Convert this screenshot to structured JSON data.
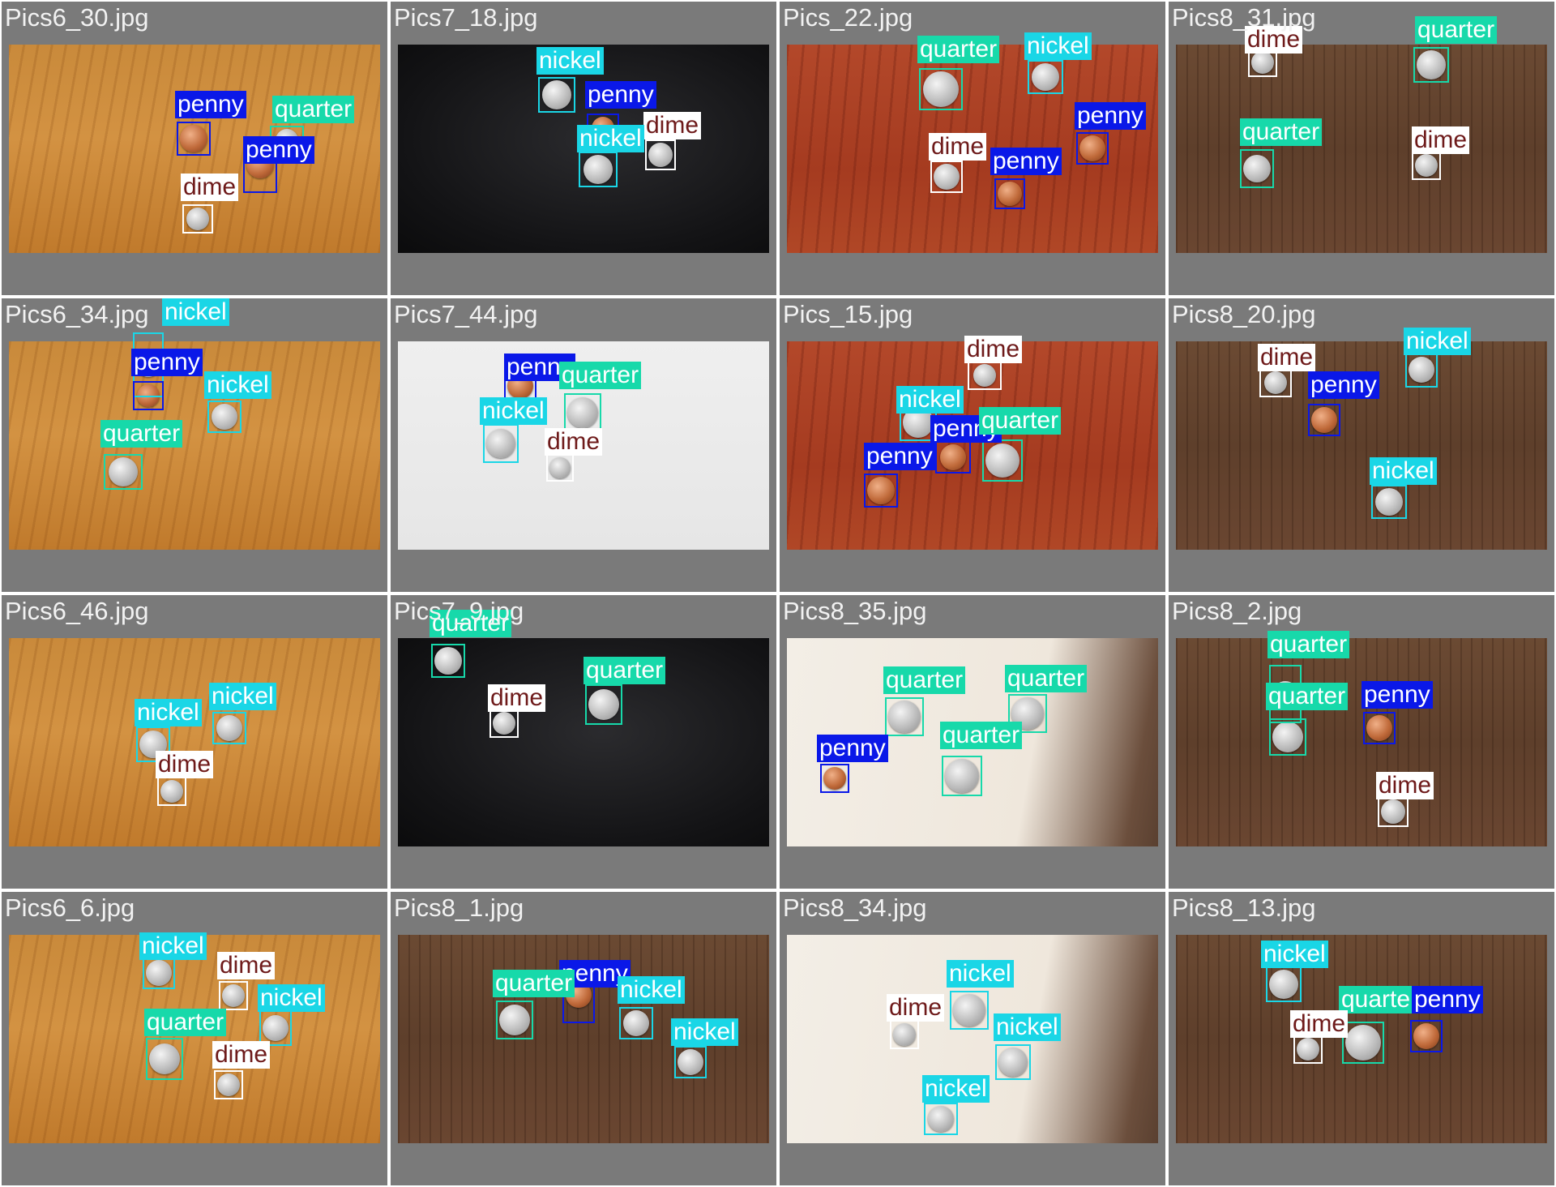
{
  "colors": {
    "penny": "#0a18e8",
    "quarter": "#17d9aa",
    "nickel": "#1ad6e6",
    "dime": "#ffffff",
    "dime_text": "#6e1a1a",
    "light_text": "#ffffff",
    "tile_bg": "#7a7a7a"
  },
  "tiles": [
    {
      "filename": "Pics6_30.jpg",
      "bg": "wood-orange",
      "detections": [
        {
          "class": "penny"
        },
        {
          "class": "quarter"
        },
        {
          "class": "penny"
        },
        {
          "class": "dime"
        }
      ]
    },
    {
      "filename": "Pics7_18.jpg",
      "bg": "dark",
      "detections": [
        {
          "class": "nickel"
        },
        {
          "class": "penny"
        },
        {
          "class": "dime"
        },
        {
          "class": "nickel"
        }
      ]
    },
    {
      "filename": "Pics_22.jpg",
      "bg": "wood-red",
      "detections": [
        {
          "class": "quarter"
        },
        {
          "class": "nickel"
        },
        {
          "class": "penny"
        },
        {
          "class": "dime"
        },
        {
          "class": "penny"
        }
      ]
    },
    {
      "filename": "Pics8_31.jpg",
      "bg": "wood-brown",
      "detections": [
        {
          "class": "dime"
        },
        {
          "class": "quarter"
        },
        {
          "class": "quarter"
        },
        {
          "class": "dime"
        }
      ]
    },
    {
      "filename": "Pics6_34.jpg",
      "bg": "wood-orange",
      "detections": [
        {
          "class": "nickel"
        },
        {
          "class": "penny"
        },
        {
          "class": "nickel"
        },
        {
          "class": "quarter"
        }
      ]
    },
    {
      "filename": "Pics7_44.jpg",
      "bg": "paper",
      "detections": [
        {
          "class": "penny"
        },
        {
          "class": "quarter"
        },
        {
          "class": "nickel"
        },
        {
          "class": "dime"
        }
      ]
    },
    {
      "filename": "Pics_15.jpg",
      "bg": "wood-red",
      "detections": [
        {
          "class": "dime"
        },
        {
          "class": "nickel"
        },
        {
          "class": "penny"
        },
        {
          "class": "quarter"
        },
        {
          "class": "penny"
        }
      ]
    },
    {
      "filename": "Pics8_20.jpg",
      "bg": "wood-brown",
      "detections": [
        {
          "class": "dime"
        },
        {
          "class": "nickel"
        },
        {
          "class": "penny"
        },
        {
          "class": "nickel"
        }
      ]
    },
    {
      "filename": "Pics6_46.jpg",
      "bg": "wood-orange",
      "detections": [
        {
          "class": "nickel"
        },
        {
          "class": "nickel"
        },
        {
          "class": "dime"
        }
      ]
    },
    {
      "filename": "Pics7_9.jpg",
      "bg": "dark",
      "detections": [
        {
          "class": "quarter"
        },
        {
          "class": "quarter"
        },
        {
          "class": "dime"
        }
      ]
    },
    {
      "filename": "Pics8_35.jpg",
      "bg": "menu",
      "detections": [
        {
          "class": "quarter"
        },
        {
          "class": "quarter"
        },
        {
          "class": "quarter"
        },
        {
          "class": "penny"
        }
      ]
    },
    {
      "filename": "Pics8_2.jpg",
      "bg": "wood-brown",
      "detections": [
        {
          "class": "quarter"
        },
        {
          "class": "quarter"
        },
        {
          "class": "penny"
        },
        {
          "class": "dime"
        }
      ]
    },
    {
      "filename": "Pics6_6.jpg",
      "bg": "wood-orange",
      "detections": [
        {
          "class": "nickel"
        },
        {
          "class": "dime"
        },
        {
          "class": "nickel"
        },
        {
          "class": "quarter"
        },
        {
          "class": "dime"
        }
      ]
    },
    {
      "filename": "Pics8_1.jpg",
      "bg": "wood-brown",
      "detections": [
        {
          "class": "penny"
        },
        {
          "class": "quarter"
        },
        {
          "class": "nickel"
        },
        {
          "class": "nickel"
        }
      ]
    },
    {
      "filename": "Pics8_34.jpg",
      "bg": "menu",
      "detections": [
        {
          "class": "nickel"
        },
        {
          "class": "dime"
        },
        {
          "class": "nickel"
        },
        {
          "class": "nickel"
        }
      ]
    },
    {
      "filename": "Pics8_13.jpg",
      "bg": "wood-brown",
      "detections": [
        {
          "class": "nickel"
        },
        {
          "class": "quarter"
        },
        {
          "class": "penny"
        },
        {
          "class": "dime"
        }
      ]
    }
  ]
}
